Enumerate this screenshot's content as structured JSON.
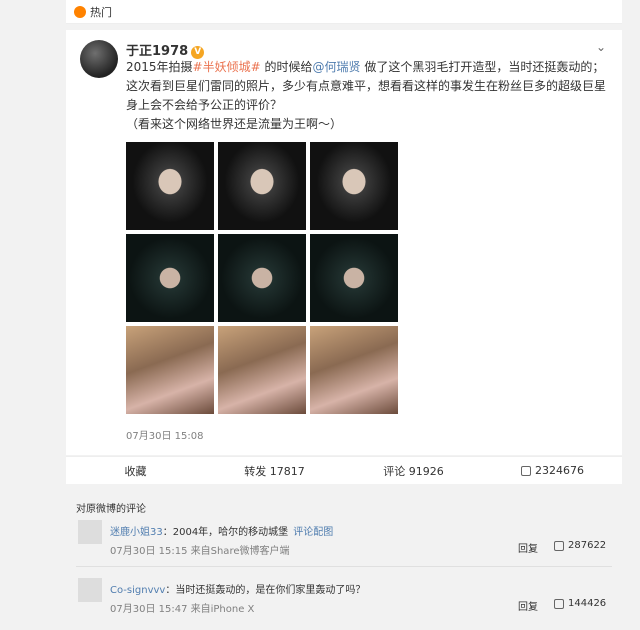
{
  "topbar": {
    "label": "热门"
  },
  "post": {
    "username": "于正1978",
    "text_line1_a": "2015年拍摄",
    "text_line1_link": "#半妖倾城#",
    "text_line1_b": " 的时候给",
    "text_line1_at": "@何瑞贤",
    "text_line1_c": " 做了这个黑羽毛打开造型，当时还挺轰动的；",
    "text_line2": "这次看到巨星们雷同的照片，多少有点意难平，想看看这样的事发生在粉丝巨多的超级巨星身上会不会给予公正的评价？",
    "text_line3": "（看来这个网络世界还是流量为王啊～）",
    "time": "07月30日 15:08"
  },
  "actions": {
    "collect": "收藏",
    "repost": "转发 17817",
    "comment": "评论 91926",
    "like": "2324676"
  },
  "comments": {
    "header": "对原微博的评论",
    "items": [
      {
        "name": "迷鹿小姐33",
        "text": "：2004年，哈尔的移动城堡",
        "extra": "评论配图",
        "meta": "07月30日 15:15 来自Share微博客户端",
        "reply": "回复",
        "likes": "287622"
      },
      {
        "name": "Co-signvvv",
        "text": "：当时还挺轰动的，是在你们家里轰动了吗？",
        "extra": "",
        "meta": "07月30日 15:47 来自iPhone X",
        "reply": "回复",
        "likes": "144426"
      }
    ]
  }
}
